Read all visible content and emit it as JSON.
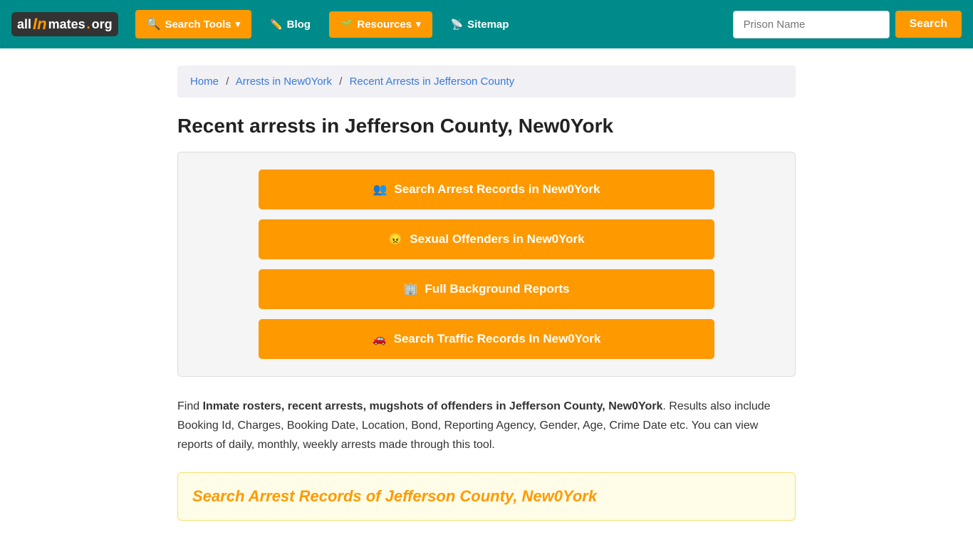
{
  "site": {
    "logo": {
      "all": "all",
      "in": "In",
      "mates": "mates",
      "dot": ".",
      "org": "org"
    }
  },
  "navbar": {
    "search_tools_label": "Search Tools",
    "blog_label": "Blog",
    "resources_label": "Resources",
    "sitemap_label": "Sitemap",
    "prison_input_placeholder": "Prison Name",
    "search_btn_label": "Search"
  },
  "breadcrumb": {
    "home": "Home",
    "arrests": "Arrests in New0York",
    "current": "Recent Arrests in Jefferson County"
  },
  "main": {
    "page_title": "Recent arrests in Jefferson County, New0York",
    "btn_arrest_records": "Search Arrest Records in New0York",
    "btn_sexual_offenders": "Sexual Offenders in New0York",
    "btn_background_reports": "Full Background Reports",
    "btn_traffic_records": "Search Traffic Records In New0York",
    "description_intro": "Find ",
    "description_bold": "Inmate rosters, recent arrests, mugshots of offenders in Jefferson County, New0York",
    "description_rest": ". Results also include Booking Id, Charges, Booking Date, Location, Bond, Reporting Agency, Gender, Age, Crime Date etc. You can view reports of daily, monthly, weekly arrests made through this tool.",
    "search_records_heading": "Search Arrest Records of Jefferson County, New0York"
  }
}
